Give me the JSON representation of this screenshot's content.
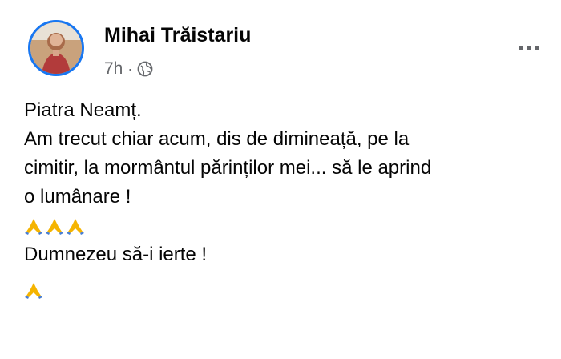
{
  "post": {
    "author": "Mihai Trăistariu",
    "time": "7h",
    "separator": "·",
    "audience_icon": "globe-icon",
    "more_icon": "more-options-icon",
    "lines": [
      "Piatra Neamț.",
      "Am trecut chiar acum, dis de dimineață, pe la",
      "cimitir, la mormântul părinților mei... să le aprind",
      "o lumânare !"
    ],
    "emoji_row_1": {
      "icon": "praying-hands-emoji",
      "count": 3
    },
    "closing_line": "Dumnezeu să-i ierte !",
    "emoji_row_2": {
      "icon": "praying-hands-emoji",
      "count": 1
    }
  },
  "colors": {
    "accent": "#1877f2",
    "meta_text": "#65676b",
    "text": "#050505",
    "emoji": "#f5b400"
  }
}
